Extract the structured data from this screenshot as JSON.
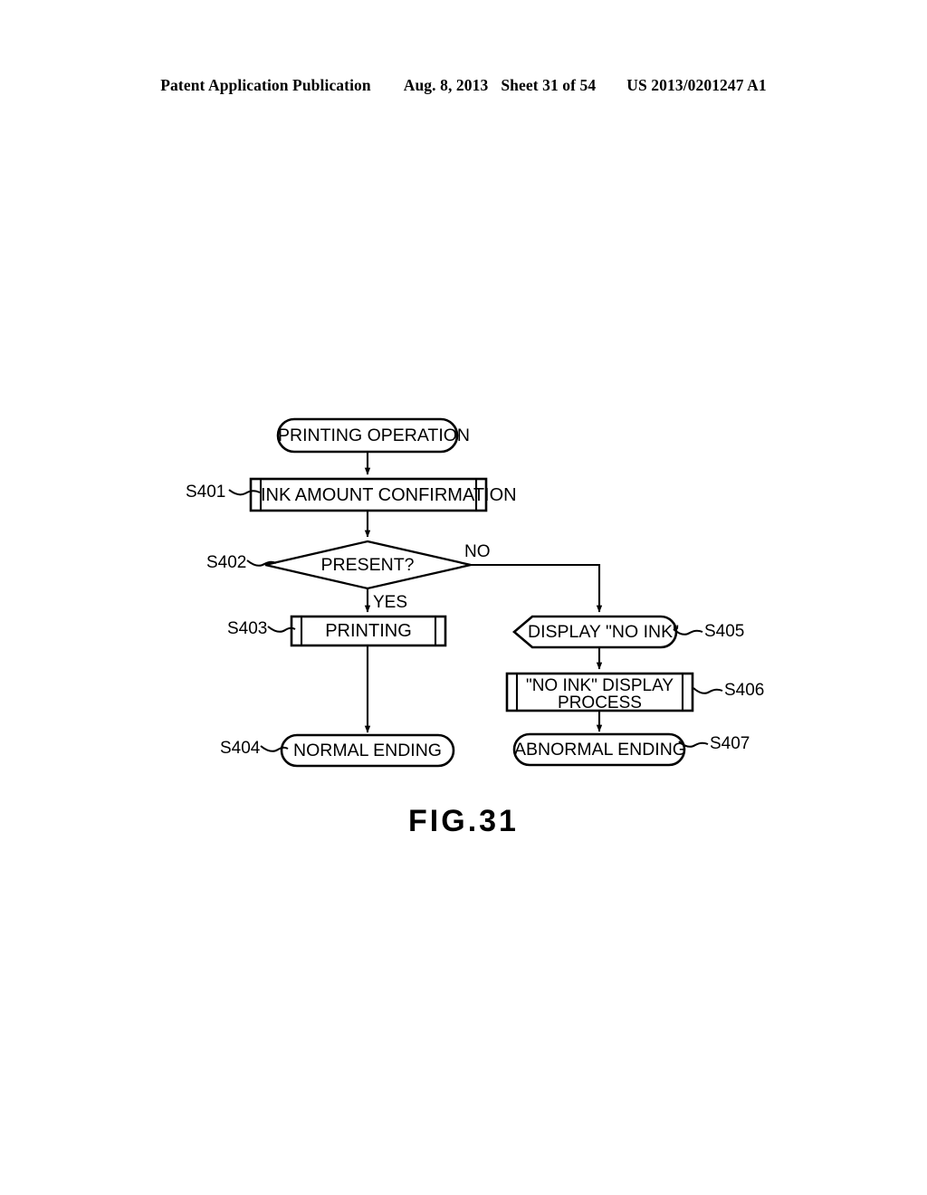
{
  "header": {
    "publication": "Patent Application Publication",
    "date": "Aug. 8, 2013",
    "sheet": "Sheet 31 of 54",
    "patent_number": "US 2013/0201247 A1"
  },
  "figure": {
    "caption": "FIG.31",
    "nodes": {
      "start": {
        "label": "PRINTING OPERATION",
        "shape": "terminator"
      },
      "s401": {
        "step": "S401",
        "label": "INK AMOUNT CONFIRMATION",
        "shape": "predefined-process"
      },
      "s402": {
        "step": "S402",
        "label": "PRESENT?",
        "shape": "decision"
      },
      "s403": {
        "step": "S403",
        "label": "PRINTING",
        "shape": "predefined-process"
      },
      "s404": {
        "step": "S404",
        "label": "NORMAL ENDING",
        "shape": "terminator"
      },
      "s405": {
        "step": "S405",
        "label": "DISPLAY \"NO INK\"",
        "shape": "display"
      },
      "s406": {
        "step": "S406",
        "label_line1": "\"NO INK\" DISPLAY",
        "label_line2": "PROCESS",
        "shape": "predefined-process"
      },
      "s407": {
        "step": "S407",
        "label": "ABNORMAL ENDING",
        "shape": "terminator"
      }
    },
    "branches": {
      "yes": "YES",
      "no": "NO"
    },
    "colors": {
      "ink": "#000000",
      "background": "#ffffff"
    }
  }
}
